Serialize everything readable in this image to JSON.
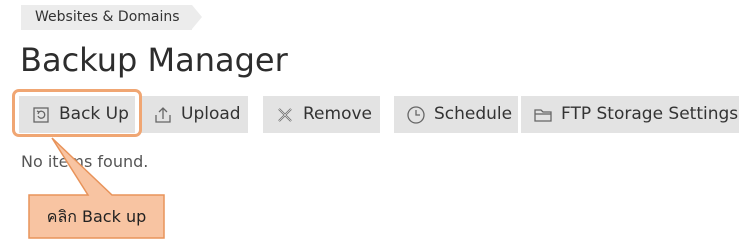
{
  "breadcrumb": {
    "label": "Websites & Domains"
  },
  "page": {
    "title": "Backup Manager"
  },
  "toolbar": {
    "back_up": {
      "label": "Back Up",
      "icon": "backup-icon"
    },
    "upload": {
      "label": "Upload",
      "icon": "upload-icon"
    },
    "remove": {
      "label": "Remove",
      "icon": "remove-icon"
    },
    "schedule": {
      "label": "Schedule",
      "icon": "clock-icon"
    },
    "ftp_storage": {
      "label": "FTP Storage Settings",
      "icon": "folder-icon"
    }
  },
  "list": {
    "empty_message": "No items found."
  },
  "annotation": {
    "callout_text": "คลิก Back up",
    "accent_color": "#f0a673",
    "fill_color": "#f8c4a2"
  }
}
